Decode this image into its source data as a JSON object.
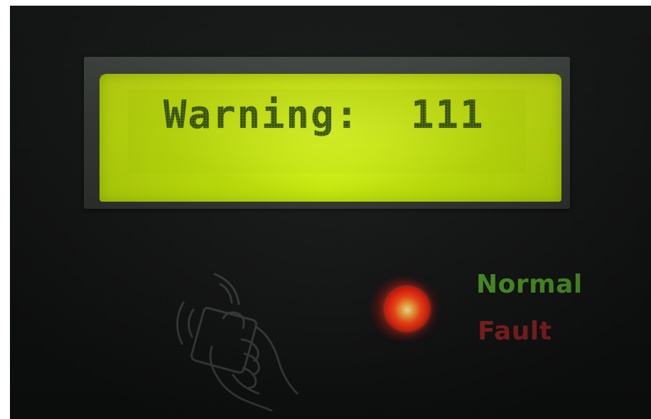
{
  "lcd": {
    "label": "Warning:",
    "code": "111",
    "backlight_color": "#cdef0c",
    "text_color": "#3d5a12"
  },
  "indicators": {
    "normal_label": "Normal",
    "fault_label": "Fault",
    "normal_color": "#4e9a23",
    "fault_color": "#8a2020",
    "led_state": "fault",
    "led_color": "#ff2a14"
  },
  "icons": {
    "rfid": "rfid-card-icon"
  }
}
